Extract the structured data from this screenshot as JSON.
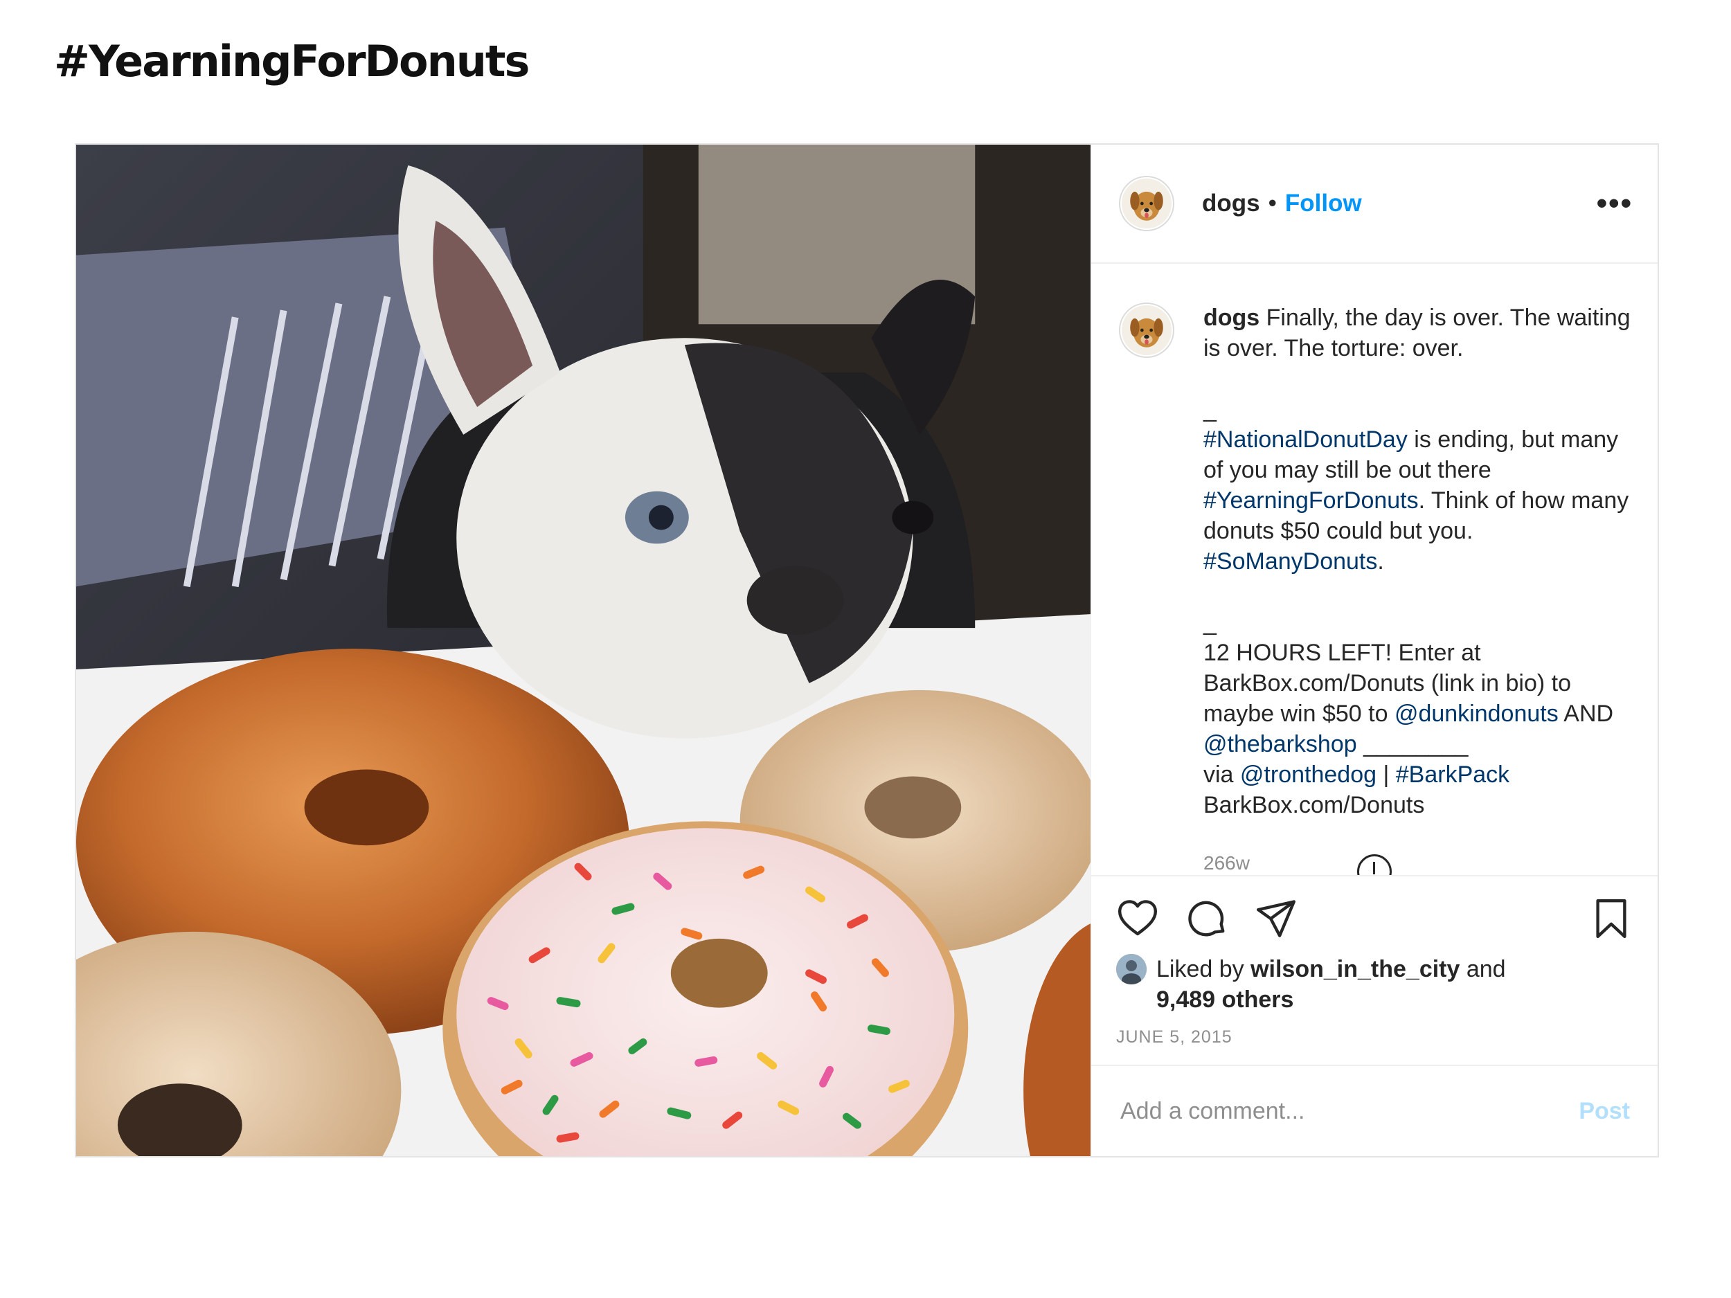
{
  "headline": "#YearningForDonuts",
  "post": {
    "username": "dogs",
    "separator": "•",
    "follow_label": "Follow",
    "more_label": "•••",
    "caption": {
      "username": "dogs",
      "line1": " Finally, the day is over. The waiting is over. The torture: over.",
      "dash1": "_",
      "hashtag_national": "#NationalDonutDay",
      "text_national": " is ending, but many of you may still be out there ",
      "hashtag_yearning": "#YearningForDonuts",
      "text_think": ". Think of how many donuts $50 could but you. ",
      "hashtag_somany": "#SoManyDonuts",
      "text_period": ".",
      "dash2": "_",
      "text_hours": "12 HOURS LEFT! Enter at BarkBox.com/Donuts (link in bio) to maybe win $50 to ",
      "mention_dunkin": "@dunkindonuts",
      "text_and": " AND ",
      "mention_barkshop": "@thebarkshop",
      "text_underline": " ________",
      "text_via": "via ",
      "mention_tron": "@tronthedog",
      "text_pipe": " | ",
      "hashtag_barkpack": "#BarkPack",
      "text_url": "BarkBox.com/Donuts"
    },
    "time_ago": "266w",
    "likes": {
      "prefix": "Liked by ",
      "user": "wilson_in_the_city",
      "mid": " and",
      "others": "9,489 others"
    },
    "date": "JUNE 5, 2015",
    "comment_placeholder": "Add a comment...",
    "post_label": "Post"
  },
  "icons": [
    "heart-icon",
    "comment-icon",
    "share-icon",
    "bookmark-icon",
    "load-more-icon"
  ],
  "colors": {
    "link_blue": "#0095f6",
    "hashtag_blue": "#00376b",
    "muted_gray": "#8e8e8e",
    "post_disabled": "#b2dffc"
  }
}
